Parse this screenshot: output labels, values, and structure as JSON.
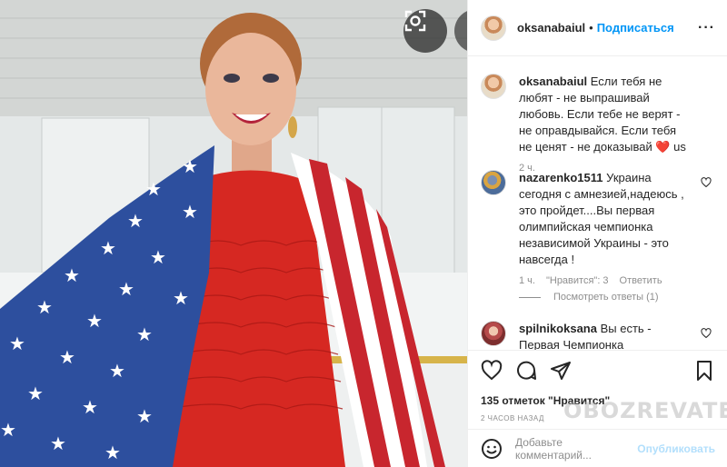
{
  "post": {
    "author": "oksanabaiul",
    "follow_label": "Подписаться",
    "more_icon": "more-icon",
    "caption": {
      "user": "oksanabaiul",
      "text": "Если тебя не любят - не выпрашивай любовь. Если тебе не верят - не оправдывайся. Если тебя не ценят - не доказывай ❤️ us",
      "time": "2 ч."
    },
    "comments": [
      {
        "user": "nazarenko1511",
        "text": "Украина сегодня с амнезией,надеюсь , это пройдет....Вы первая олимпийская чемпионка независимой Украины - это навсегда !",
        "time": "1 ч.",
        "likes": "\"Нравится\": 3",
        "reply_label": "Ответить",
        "view_replies": "Посмотреть ответы (1)"
      },
      {
        "user": "spilnikoksana",
        "text": "Вы есть - Первая Чемпионка Независимой"
      }
    ],
    "likes_text": "135 отметок \"Нравится\"",
    "time_ago": "2 ЧАСОВ НАЗАД",
    "watermark": "OBOZREVATEL",
    "add_comment_placeholder": "Добавьте комментарий...",
    "publish_label": "Опубликовать"
  }
}
